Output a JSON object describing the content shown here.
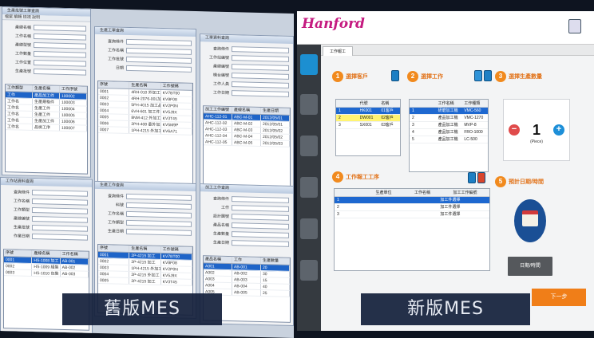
{
  "old_mes": {
    "caption": "舊版MES",
    "windows": [
      {
        "title": "生產批號工單查詢",
        "menu": "檔案 編輯 檢視 說明",
        "fields": [
          {
            "label": "產線名稱"
          },
          {
            "label": "工作名稱"
          },
          {
            "label": "產線型號"
          },
          {
            "label": "工作數量"
          },
          {
            "label": "工作位置"
          },
          {
            "label": "生產批號"
          }
        ],
        "headers": [
          "工作類型",
          "生產名稱",
          "工作序號"
        ],
        "rows": [
          [
            "工作",
            "產品加工件",
            "100002"
          ],
          [
            "工作名",
            "生產規格件",
            "100003"
          ],
          [
            "工作名",
            "生產工件",
            "100004"
          ],
          [
            "工作名",
            "生產工件",
            "100005"
          ],
          [
            "工作名",
            "生產加工件",
            "100006"
          ],
          [
            "工作名",
            "品檢工序",
            "100007"
          ]
        ],
        "selected": 0
      },
      {
        "title": "生產工單查詢",
        "menu": "",
        "fields": [
          {
            "label": "查詢條件"
          },
          {
            "label": "工作名稱"
          },
          {
            "label": "工作批號"
          },
          {
            "label": "日期"
          }
        ],
        "headers": [
          "序號",
          "生產名稱",
          "工作號碼"
        ],
        "rows": [
          [
            "0001",
            "4RH-010 外加工件",
            "KV7BT00"
          ],
          [
            "0002",
            "4RH-2076-001加工",
            "KV8F08"
          ],
          [
            "0003",
            "5FH-4015 加工品",
            "KV2P0N"
          ],
          [
            "0004",
            "6VH-601 加工件",
            "KV5J9X"
          ],
          [
            "0005",
            "8NM-412 外加工",
            "KV3T45"
          ],
          [
            "0006",
            "2PH-408 委外加工",
            "KV5M9P"
          ],
          [
            "0007",
            "1PH-4215 外加工",
            "KV6A71"
          ]
        ],
        "selected": -1
      },
      {
        "title": "工單資料查詢",
        "menu": "",
        "fields": [
          {
            "label": "查詢條件"
          },
          {
            "label": "工作站編號"
          },
          {
            "label": "產線編號"
          },
          {
            "label": "機台編號"
          },
          {
            "label": "工作人員"
          },
          {
            "label": "工作日期"
          }
        ],
        "headers": [
          "加工工作編號",
          "產線名稱",
          "生產日期"
        ],
        "rows": [
          [
            "AHC-112-01",
            "ABC-M-01",
            "2012/05/01"
          ],
          [
            "AHC-112-02",
            "ABC-M-02",
            "2012/05/01"
          ],
          [
            "AHC-112-03",
            "ABC-M-03",
            "2012/05/02"
          ],
          [
            "AHC-112-04",
            "ABC-M-04",
            "2012/05/02"
          ],
          [
            "AHC-112-05",
            "ABC-M-05",
            "2012/05/03"
          ]
        ],
        "selected": 0
      },
      {
        "title": "工作站資料查詢",
        "menu": "",
        "fields": [
          {
            "label": "查詢條件"
          },
          {
            "label": "工作名稱"
          },
          {
            "label": "工作類型"
          },
          {
            "label": "產線編號"
          },
          {
            "label": "生產批號"
          },
          {
            "label": "作業日期"
          }
        ],
        "headers": [
          "序號",
          "產線名稱",
          "工作名稱"
        ],
        "rows": [
          [
            "0001",
            "HS-1008 加工",
            "AB-001"
          ],
          [
            "0002",
            "HS-1009 組裝",
            "AB-002"
          ],
          [
            "0003",
            "HS-1010 包裝",
            "AB-003"
          ]
        ],
        "selected": 0
      },
      {
        "title": "生產工作查詢",
        "menu": "",
        "fields": [
          {
            "label": "查詢條件"
          },
          {
            "label": "料號"
          },
          {
            "label": "工作名稱"
          },
          {
            "label": "工作類型"
          },
          {
            "label": "生產日期"
          }
        ],
        "headers": [
          "序號",
          "生產名稱",
          "工作號碼"
        ],
        "rows": [
          [
            "0001",
            "2P-4215 加工",
            "KV7BT00"
          ],
          [
            "0002",
            "2P-4215 加工",
            "KV8F08"
          ],
          [
            "0003",
            "1PH-4215 外加工",
            "KV2P0N"
          ],
          [
            "0004",
            "2P-4215 外加工",
            "KV5J9X"
          ],
          [
            "0005",
            "2P-4215 加工",
            "KV3T45"
          ]
        ],
        "selected": 0
      },
      {
        "title": "加工工作查詢",
        "menu": "",
        "fields": [
          {
            "label": "查詢條件"
          },
          {
            "label": "工作"
          },
          {
            "label": "設計圖號"
          },
          {
            "label": "產品名稱"
          },
          {
            "label": "生產數量"
          },
          {
            "label": "生產日期"
          }
        ],
        "headers": [
          "產品名稱",
          "工作",
          "生產數量"
        ],
        "rows": [
          [
            "A001",
            "AB-001",
            "20"
          ],
          [
            "A002",
            "AB-002",
            "30"
          ],
          [
            "A003",
            "AB-003",
            "15"
          ],
          [
            "A004",
            "AB-004",
            "40"
          ],
          [
            "A005",
            "AB-005",
            "25"
          ]
        ],
        "selected": 0
      }
    ]
  },
  "new_mes": {
    "caption": "新版MES",
    "logo": "Hanford",
    "tab_label": "工作報工",
    "step1": {
      "num": "1",
      "title": "選擇客戶",
      "headers": [
        "代號",
        "名稱"
      ],
      "rows": [
        [
          "1",
          "HK001",
          "01客戶"
        ],
        [
          "2",
          "DW001",
          "02客戶"
        ],
        [
          "3",
          "SX001",
          "03客戶"
        ]
      ]
    },
    "step2": {
      "num": "2",
      "title": "選擇工作",
      "headers": [
        "工作名稱",
        "工作種類"
      ],
      "rows": [
        [
          "1",
          "研磨加工機",
          "VMC-560"
        ],
        [
          "2",
          "產品加工機",
          "VMC-1270"
        ],
        [
          "3",
          "產品加工機",
          "MVP-8"
        ],
        [
          "4",
          "產品加工機",
          "FRO-1000"
        ],
        [
          "5",
          "產品加工機",
          "LC-500"
        ]
      ]
    },
    "step3": {
      "num": "3",
      "title": "選擇生產數量",
      "quantity": "1",
      "unit": "(Piece)",
      "minus": "−",
      "plus": "+"
    },
    "step4": {
      "num": "4",
      "title": "工作報工工序",
      "headers": [
        "生產單位",
        "工作名稱",
        "加工工作編號"
      ],
      "rows": [
        [
          "1",
          "",
          "加工件選擇"
        ],
        [
          "2",
          "",
          "加工件選擇"
        ],
        [
          "3",
          "",
          "加工件選擇"
        ]
      ]
    },
    "step5": {
      "num": "5",
      "title": "預計日期/時間",
      "button": "日期/時間"
    },
    "next_button": "下一步"
  },
  "colors": {
    "accent_orange": "#f18a1e",
    "select_blue": "#1e68d0",
    "sidebar": "#353a40"
  }
}
